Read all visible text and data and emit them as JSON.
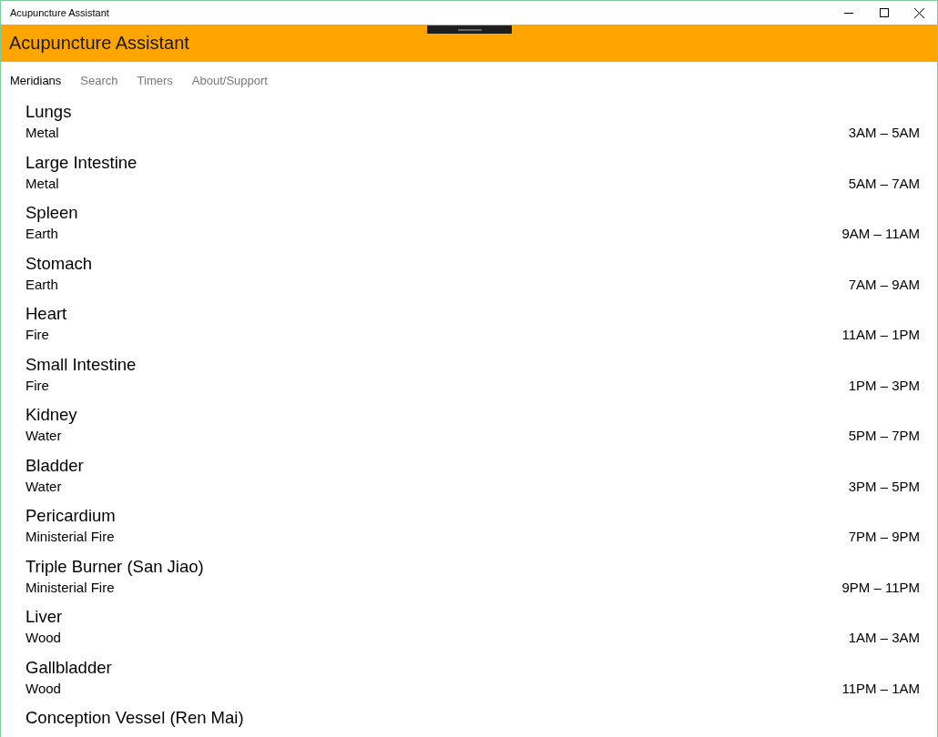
{
  "window": {
    "title": "Acupuncture Assistant"
  },
  "header": {
    "title": "Acupuncture Assistant"
  },
  "tabs": [
    {
      "label": "Meridians",
      "selected": true
    },
    {
      "label": "Search",
      "selected": false
    },
    {
      "label": "Timers",
      "selected": false
    },
    {
      "label": "About/Support",
      "selected": false
    }
  ],
  "meridians": [
    {
      "name": "Lungs",
      "element": "Metal",
      "time": "3AM – 5AM"
    },
    {
      "name": "Large Intestine",
      "element": "Metal",
      "time": "5AM – 7AM"
    },
    {
      "name": "Spleen",
      "element": "Earth",
      "time": "9AM – 11AM"
    },
    {
      "name": "Stomach",
      "element": "Earth",
      "time": "7AM – 9AM"
    },
    {
      "name": "Heart",
      "element": "Fire",
      "time": "11AM – 1PM"
    },
    {
      "name": "Small Intestine",
      "element": "Fire",
      "time": "1PM – 3PM"
    },
    {
      "name": "Kidney",
      "element": "Water",
      "time": "5PM – 7PM"
    },
    {
      "name": "Bladder",
      "element": "Water",
      "time": "3PM – 5PM"
    },
    {
      "name": "Pericardium",
      "element": "Ministerial Fire",
      "time": "7PM – 9PM"
    },
    {
      "name": "Triple Burner (San Jiao)",
      "element": "Ministerial Fire",
      "time": "9PM – 11PM"
    },
    {
      "name": "Liver",
      "element": "Wood",
      "time": "1AM – 3AM"
    },
    {
      "name": "Gallbladder",
      "element": "Wood",
      "time": "11PM – 1AM"
    },
    {
      "name": "Conception Vessel (Ren Mai)"
    }
  ]
}
